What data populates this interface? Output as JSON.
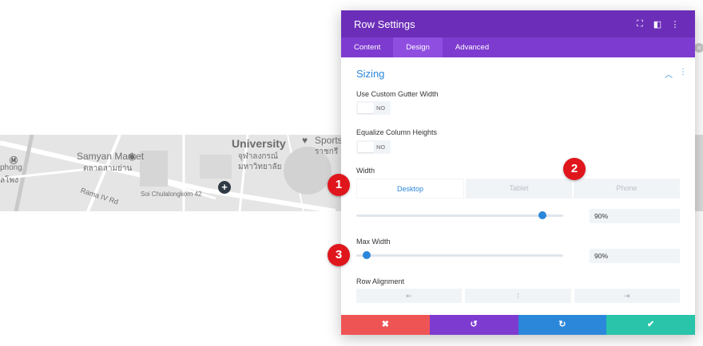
{
  "map": {
    "labels": {
      "samyan": "Samyan Market",
      "samyan_thai": "ตลาดสามย่าน",
      "university": "University",
      "university_thai_1": "จุฬาลงกรณ์",
      "university_thai_2": "มหาวิทยาลัย",
      "sports": "Sports",
      "sports_thai": "ราชกรี",
      "phong": "phong",
      "phong_thai": "ลโพง",
      "rama": "Rama IV Rd",
      "soi": "Soi Chulalongkorn 42"
    },
    "plus": "+",
    "close": "×"
  },
  "modal": {
    "title": "Row Settings",
    "header_icons": [
      "expand-icon",
      "columns-icon",
      "more-icon"
    ],
    "tabs": [
      "Content",
      "Design",
      "Advanced"
    ],
    "active_tab": "Design",
    "section_title": "Sizing",
    "fields": {
      "gutter_label": "Use Custom Gutter Width",
      "gutter_state": "NO",
      "equalize_label": "Equalize Column Heights",
      "equalize_state": "NO",
      "width_label": "Width",
      "devices": [
        "Desktop",
        "Tablet",
        "Phone"
      ],
      "active_device": "Desktop",
      "width_value": "90%",
      "width_level": 0.9,
      "max_width_label": "Max Width",
      "max_width_value": "90%",
      "max_width_level": 0.05,
      "row_alignment_label": "Row Alignment"
    },
    "footer": {
      "cancel": "✖",
      "undo": "↺",
      "redo": "↻",
      "save": "✔"
    },
    "colors": {
      "header": "#6c2eb9",
      "tabs": "#7e3bd0",
      "accent": "#2b87da",
      "cancel": "#ef5455",
      "undo": "#7e3bd0",
      "redo": "#2b87da",
      "save": "#29c4a9"
    }
  },
  "markers": [
    "1",
    "2",
    "3"
  ]
}
